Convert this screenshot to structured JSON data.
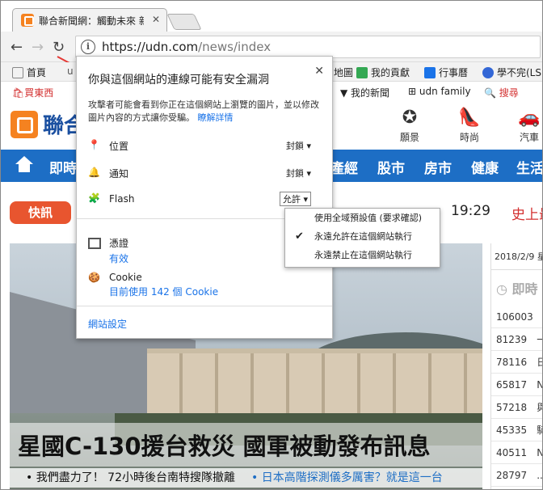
{
  "tab": {
    "title": "聯合新聞網：觸動未來 新"
  },
  "toolbar": {
    "url_host": "https://udn.com",
    "url_path": "/news/index"
  },
  "bookmarks": [
    "首頁",
    "u",
    "地圖",
    "我的貢獻",
    "行事曆",
    "學不完(LS"
  ],
  "subnav": [
    "買東西",
    "我的新聞",
    "udn family",
    "搜尋"
  ],
  "site": {
    "logo": "聯合",
    "categories": [
      "願景",
      "時尚",
      "汽車"
    ],
    "nav": [
      "即時",
      "產經",
      "股市",
      "房市",
      "健康",
      "生活"
    ],
    "quick": "快訊",
    "time": "19:29",
    "red": "史上最"
  },
  "headline": "星國C-130援台救災 國軍被動發布訊息",
  "subline": {
    "left": "我們盡力了！ 72小時後台南特搜隊撤離",
    "right": "日本高階探測儀多厲害？就是這一台"
  },
  "side": {
    "date": "2018/2/9 星",
    "heading": "即時",
    "rows": [
      {
        "n": "106003",
        "t": "NI"
      },
      {
        "n": "81239",
        "t": "一"
      },
      {
        "n": "78116",
        "t": "日"
      },
      {
        "n": "65817",
        "t": "NI"
      },
      {
        "n": "57218",
        "t": "與"
      },
      {
        "n": "45335",
        "t": "騎"
      },
      {
        "n": "40511",
        "t": "NI"
      },
      {
        "n": "28797",
        "t": "..."
      }
    ]
  },
  "popup": {
    "title": "你與這個網站的連線可能有安全漏洞",
    "desc": "攻擊者可能會看到你正在這個網站上瀏覽的圖片，並以修改圖片內容的方式讓你受騙。",
    "learn": "瞭解詳情",
    "perms": [
      {
        "label": "位置",
        "value": "封鎖"
      },
      {
        "label": "通知",
        "value": "封鎖"
      },
      {
        "label": "Flash",
        "value": "允許"
      }
    ],
    "cert": {
      "label": "憑證",
      "sub": "有效"
    },
    "cookie": {
      "label": "Cookie",
      "sub": "目前使用 142 個 Cookie"
    },
    "settings": "網站設定"
  },
  "dropdown": [
    "使用全域預設值 (要求確認)",
    "永遠允許在這個網站執行",
    "永遠禁止在這個網站執行"
  ]
}
